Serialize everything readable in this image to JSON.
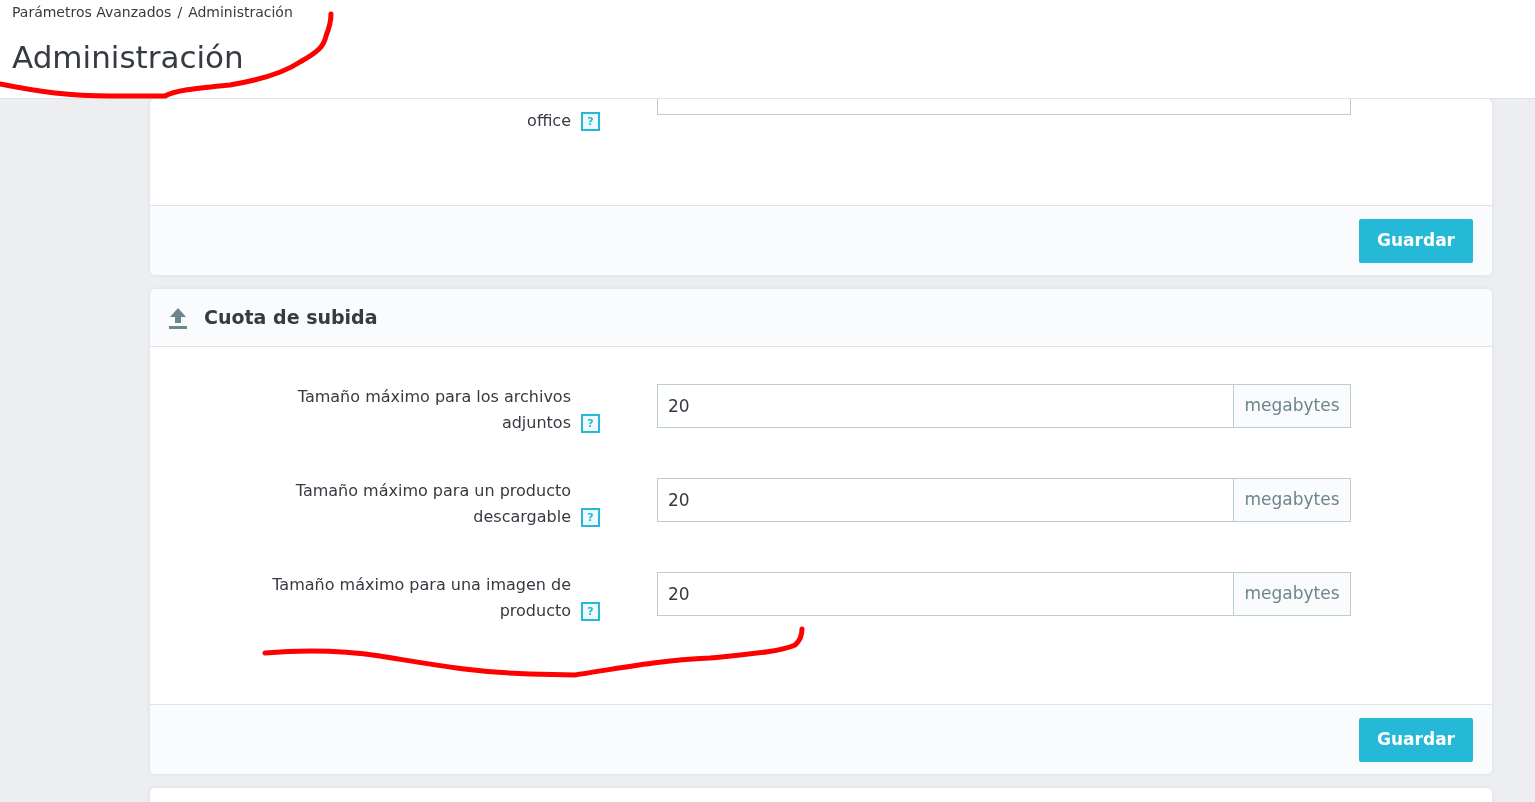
{
  "breadcrumb": [
    "Parámetros Avanzados",
    "Administración"
  ],
  "breadcrumb_separator": "/",
  "page_title": "Administración",
  "sections": [
    {
      "fields": [
        {
          "label": "office",
          "help": "?"
        }
      ],
      "button": "Guardar"
    },
    {
      "title": "Cuota de subida",
      "fields": [
        {
          "label": "Tamaño máximo para los archivos adjuntos",
          "help": "?",
          "value": "20",
          "unit": "megabytes"
        },
        {
          "label": "Tamaño máximo para un producto descargable",
          "help": "?",
          "value": "20",
          "unit": "megabytes"
        },
        {
          "label": "Tamaño máximo para una imagen de producto",
          "help": "?",
          "value": "20",
          "unit": "megabytes"
        }
      ],
      "button": "Guardar"
    }
  ]
}
